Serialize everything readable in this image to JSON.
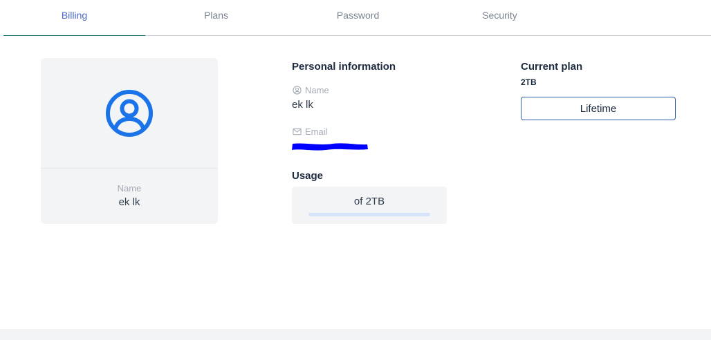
{
  "tabs": [
    {
      "label": "Billing",
      "active": true
    },
    {
      "label": "Plans",
      "active": false
    },
    {
      "label": "Password",
      "active": false
    },
    {
      "label": "Security",
      "active": false
    }
  ],
  "profile": {
    "name_label": "Name",
    "name_value": "ek lk",
    "avatar_icon": "user-circle-icon"
  },
  "personal_info": {
    "title": "Personal information",
    "name_label": "Name",
    "name_value": "ek lk",
    "email_label": "Email",
    "email_value": ""
  },
  "usage": {
    "title": "Usage",
    "text": "of 2TB",
    "progress": 0
  },
  "plan": {
    "title": "Current plan",
    "size": "2TB",
    "button_label": "Lifetime"
  },
  "colors": {
    "accent": "#4a67c8",
    "avatar": "#1a73e8",
    "redaction": "#0000ff"
  }
}
